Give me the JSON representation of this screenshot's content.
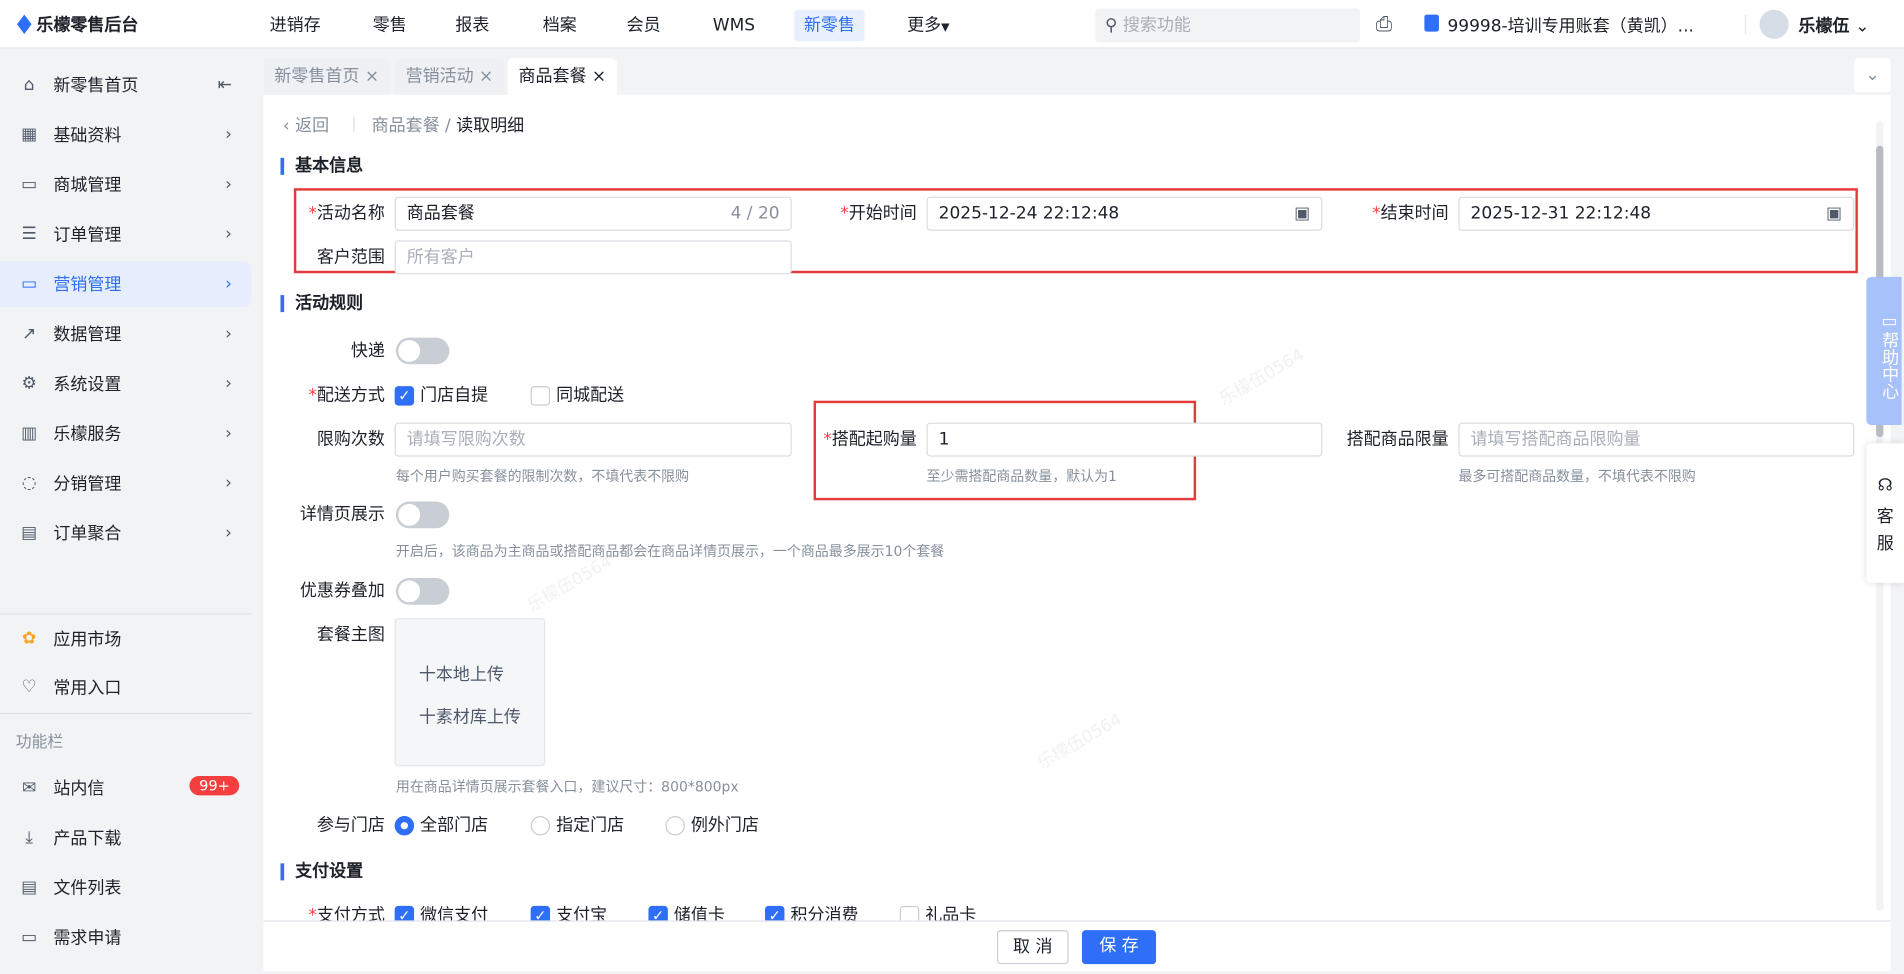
{
  "app": {
    "title": "乐檬零售后台"
  },
  "nav": [
    "进销存",
    "零售",
    "报表",
    "档案",
    "会员",
    "WMS",
    "新零售",
    "更多"
  ],
  "search": {
    "placeholder": "搜索功能"
  },
  "account": {
    "name": "99998-培训专用账套（黄凯）...",
    "user": "乐檬伍"
  },
  "sidebar": {
    "items": [
      "新零售首页",
      "基础资料",
      "商城管理",
      "订单管理",
      "营销管理",
      "数据管理",
      "系统设置",
      "乐檬服务",
      "分销管理",
      "订单聚合"
    ],
    "extra": [
      "应用市场",
      "常用入口"
    ],
    "section": "功能栏",
    "tools": [
      "站内信",
      "产品下载",
      "文件列表",
      "需求申请"
    ],
    "badge": "99+"
  },
  "tabs": [
    "新零售首页",
    "营销活动",
    "商品套餐"
  ],
  "breadcrumb": {
    "back": "返回",
    "parent": "商品套餐",
    "current": "读取明细"
  },
  "basic": {
    "title": "基本信息",
    "name_label": "活动名称",
    "name_value": "商品套餐",
    "name_count": "4 / 20",
    "start_label": "开始时间",
    "start_value": "2025-12-24 22:12:48",
    "end_label": "结束时间",
    "end_value": "2025-12-31 22:12:48",
    "scope_label": "客户范围",
    "scope_placeholder": "所有客户"
  },
  "rules": {
    "title": "活动规则",
    "express": "快递",
    "delivery_label": "配送方式",
    "delivery_opts": [
      "门店自提",
      "同城配送"
    ],
    "limit_label": "限购次数",
    "limit_placeholder": "请填写限购次数",
    "limit_hint": "每个用户购买套餐的限制次数，不填代表不限购",
    "min_label": "搭配起购量",
    "min_value": "1",
    "min_hint": "至少需搭配商品数量，默认为1",
    "max_label": "搭配商品限量",
    "max_placeholder": "请填写搭配商品限购量",
    "max_hint": "最多可搭配商品数量，不填代表不限购",
    "detail_label": "详情页展示",
    "detail_hint": "开启后，该商品为主商品或搭配商品都会在商品详情页展示，一个商品最多展示10个套餐",
    "coupon_label": "优惠券叠加",
    "image_label": "套餐主图",
    "upload_local": "十本地上传",
    "upload_lib": "十素材库上传",
    "image_hint": "用在商品详情页展示套餐入口，建议尺寸：800*800px",
    "store_label": "参与门店",
    "store_opts": [
      "全部门店",
      "指定门店",
      "例外门店"
    ]
  },
  "pay": {
    "title": "支付设置",
    "label": "支付方式",
    "opts": [
      "微信支付",
      "支付宝",
      "储值卡",
      "积分消费",
      "礼品卡"
    ]
  },
  "footer": {
    "cancel": "取 消",
    "save": "保 存"
  },
  "float": {
    "help": "帮助中心",
    "service": "客服"
  },
  "watermark": "乐檬伍0564",
  "colors": {
    "accent": "#2f6ef6",
    "highlight_box": "#e5393a",
    "badge": "#f53f3f"
  }
}
